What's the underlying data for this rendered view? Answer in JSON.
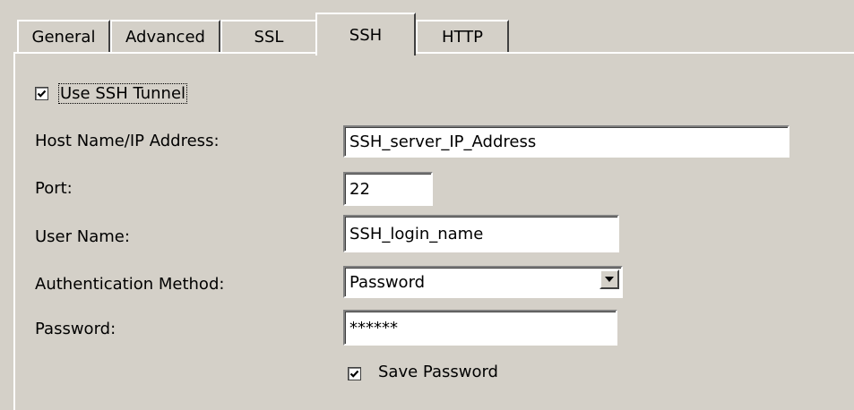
{
  "tabs": [
    {
      "label": "General",
      "active": false
    },
    {
      "label": "Advanced",
      "active": false
    },
    {
      "label": "SSL",
      "active": false
    },
    {
      "label": "SSH",
      "active": true
    },
    {
      "label": "HTTP",
      "active": false
    }
  ],
  "ssh": {
    "use_tunnel": {
      "label": "Use SSH Tunnel",
      "checked": true
    },
    "host": {
      "label": "Host Name/IP Address:",
      "value": "SSH_server_IP_Address"
    },
    "port": {
      "label": "Port:",
      "value": "22"
    },
    "user": {
      "label": "User Name:",
      "value": "SSH_login_name"
    },
    "auth": {
      "label": "Authentication Method:",
      "value": "Password",
      "icon": "chevron-down-icon"
    },
    "password": {
      "label": "Password:",
      "value": "******"
    },
    "save_password": {
      "label": "Save Password",
      "checked": true
    }
  },
  "colors": {
    "face": "#d4d0c8",
    "highlight": "#ffffff",
    "shadow": "#404040"
  }
}
